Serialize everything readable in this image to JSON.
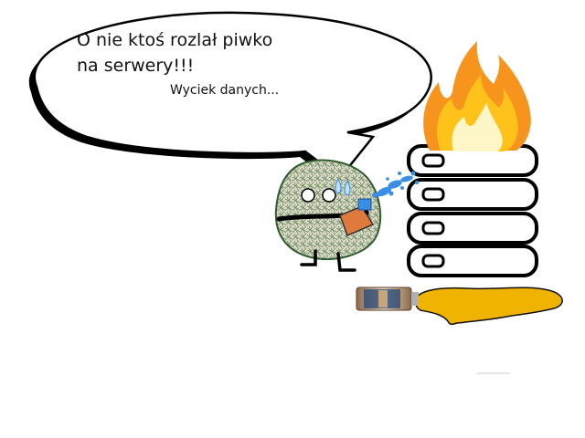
{
  "speech_bubble": {
    "line1": "O nie ktoś rozlał piwko",
    "line2": "na serwery!!!",
    "line3": "Wyciek danych..."
  },
  "colors": {
    "background": "#ffffff",
    "flame_outer": "#f7941d",
    "flame_mid": "#ffc21a",
    "flame_inner": "#fff6c8",
    "beer_puddle": "#f0b400",
    "water_spray": "#3a8ee6",
    "creature_body": "#c9cdb3",
    "creature_outline": "#2f5d2f"
  },
  "icons": {
    "bubble": "speech-bubble",
    "flame": "fire-icon",
    "server": "server-rack-icon",
    "bottle": "beer-bottle-icon",
    "puddle": "beer-puddle",
    "creature": "fuzzy-creature",
    "extinguisher": "spray-bottle-icon"
  }
}
